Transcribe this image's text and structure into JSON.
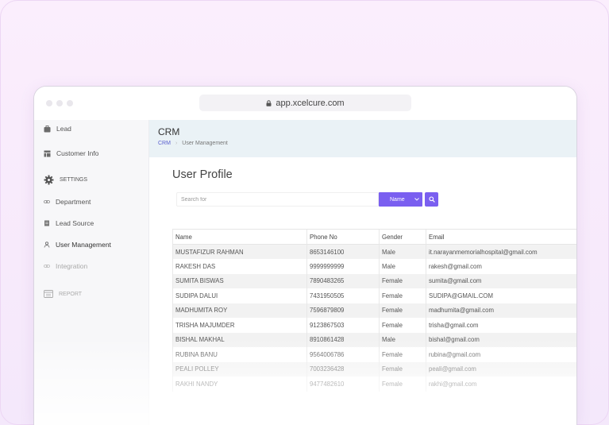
{
  "browser": {
    "url": "app.xcelcure.com"
  },
  "sidebar": {
    "items": [
      {
        "label": "Lead",
        "icon": "briefcase-icon"
      },
      {
        "label": "Customer Info",
        "icon": "table-icon"
      },
      {
        "label": "SETTINGS",
        "icon": "gear-icon"
      },
      {
        "label": "Department",
        "icon": "link-icon"
      },
      {
        "label": "Lead Source",
        "icon": "document-icon"
      },
      {
        "label": "User Management",
        "icon": "user-icon"
      },
      {
        "label": "Integration",
        "icon": "link-icon"
      },
      {
        "label": "REPORT",
        "icon": "report-icon"
      }
    ]
  },
  "header": {
    "title": "CRM",
    "breadcrumb": [
      "CRM",
      "User Management"
    ]
  },
  "main": {
    "page_title": "User Profile",
    "search": {
      "placeholder": "Search for",
      "filter_selected": "Name"
    }
  },
  "table": {
    "columns": [
      "Name",
      "Phone No",
      "Gender",
      "Email"
    ],
    "rows": [
      [
        "MUSTAFIZUR RAHMAN",
        "8653146100",
        "Male",
        "it.narayanmemorialhospital@gmail.com"
      ],
      [
        "RAKESH DAS",
        "9999999999",
        "Male",
        "rakesh@gmail.com"
      ],
      [
        "SUMITA BISWAS",
        "7890483265",
        "Female",
        "sumita@gmail.com"
      ],
      [
        "SUDIPA DALUI",
        "7431950505",
        "Female",
        "SUDIPA@GMAIL.COM"
      ],
      [
        "MADHUMITA ROY",
        "7596879809",
        "Female",
        "madhumita@gmail.com"
      ],
      [
        "TRISHA MAJUMDER",
        "9123867503",
        "Female",
        "trisha@gmail.com"
      ],
      [
        "BISHAL MAKHAL",
        "8910861428",
        "Male",
        "bishal@gmail.com"
      ],
      [
        "RUBINA BANU",
        "9564006786",
        "Female",
        "rubina@gmail.com"
      ],
      [
        "PEALI POLLEY",
        "7003236428",
        "Female",
        "peali@gmail.com"
      ],
      [
        "RAKHI NANDY",
        "9477482610",
        "Female",
        "rakhi@gmail.com"
      ]
    ]
  },
  "colors": {
    "accent": "#7a5ff0",
    "breadcrumb_link": "#5a5fcf",
    "header_bg": "#eaf2f6"
  }
}
